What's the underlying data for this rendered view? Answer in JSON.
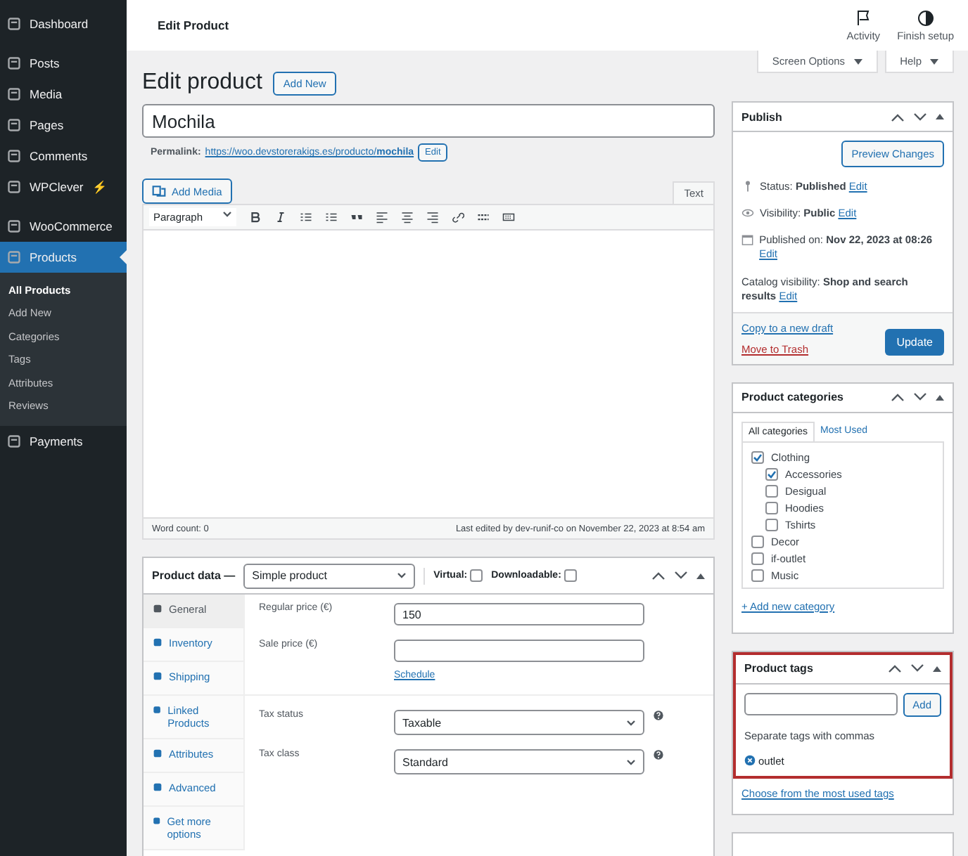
{
  "sidebar": {
    "items": [
      {
        "label": "Dashboard",
        "kind": "main",
        "selected": false
      },
      {
        "label": "Posts",
        "kind": "main",
        "selected": false
      },
      {
        "label": "Media",
        "kind": "main",
        "selected": false
      },
      {
        "label": "Pages",
        "kind": "main",
        "selected": false
      },
      {
        "label": "Comments",
        "kind": "main",
        "selected": false
      },
      {
        "label": "WPClever",
        "kind": "main",
        "selected": false,
        "badge": "⚡"
      },
      {
        "label": "WooCommerce",
        "kind": "main",
        "selected": false
      },
      {
        "label": "Products",
        "kind": "main",
        "selected": true
      },
      {
        "label": "All Products",
        "kind": "sub",
        "selected": true
      },
      {
        "label": "Add New",
        "kind": "sub",
        "selected": false
      },
      {
        "label": "Categories",
        "kind": "sub",
        "selected": false
      },
      {
        "label": "Tags",
        "kind": "sub",
        "selected": false
      },
      {
        "label": "Attributes",
        "kind": "sub",
        "selected": false
      },
      {
        "label": "Reviews",
        "kind": "sub",
        "selected": false
      },
      {
        "label": "Payments",
        "kind": "main",
        "selected": false
      }
    ]
  },
  "topbar": {
    "title": "Edit Product",
    "actions": [
      "Activity",
      "Finish setup"
    ]
  },
  "screen_buttons": [
    "Screen Options",
    "Help"
  ],
  "heading": {
    "title": "Edit product",
    "add_new": "Add New"
  },
  "product_title": "Mochila",
  "permalink": {
    "label": "Permalink:",
    "url_prefix": "https://woo.devstorerakigs.es/producto/",
    "slug": "mochila",
    "edit": "Edit"
  },
  "editor": {
    "add_media": "Add Media",
    "mode_tab": "Text",
    "format": "Paragraph",
    "word_count": "Word count: 0",
    "last_edited": "Last edited by dev-runif-co on November 22, 2023 at 8:54 am"
  },
  "product_data": {
    "label": "Product data —",
    "type": "Simple product",
    "checks": [
      {
        "label": "Virtual:",
        "checked": false
      },
      {
        "label": "Downloadable:",
        "checked": false
      }
    ],
    "tabs": [
      {
        "label": "General",
        "selected": true
      },
      {
        "label": "Inventory",
        "selected": false
      },
      {
        "label": "Shipping",
        "selected": false
      },
      {
        "label": "Linked Products",
        "selected": false
      },
      {
        "label": "Attributes",
        "selected": false
      },
      {
        "label": "Advanced",
        "selected": false
      },
      {
        "label": "Get more options",
        "selected": false
      }
    ],
    "fields": [
      {
        "kind": "input",
        "label": "Regular price (€)",
        "value": "150"
      },
      {
        "kind": "input",
        "label": "Sale price (€)",
        "link": "Schedule"
      },
      {
        "kind": "divider"
      },
      {
        "kind": "select",
        "label": "Tax status",
        "value": "Taxable"
      },
      {
        "kind": "select",
        "label": "Tax class",
        "value": "Standard"
      }
    ]
  },
  "publish": {
    "title": "Publish",
    "preview": "Preview Changes",
    "rows": [
      {
        "text": "Status: **Published**",
        "edit": "Edit"
      },
      {
        "text": "Visibility: **Public**",
        "edit": "Edit"
      },
      {
        "text": "Published on: **Nov 22, 2023 at 08:26**",
        "edit": "Edit"
      },
      {
        "text": "Catalog visibility: **Shop and search results**",
        "edit": "Edit"
      }
    ],
    "copy": "Copy to a new draft",
    "trash": "Move to Trash",
    "update": "Update"
  },
  "categories": {
    "title": "Product categories",
    "tabs": [
      {
        "label": "All categories",
        "selected": true
      },
      {
        "label": "Most Used",
        "selected": false
      }
    ],
    "items": [
      {
        "label": "Clothing",
        "checked": true,
        "children": [
          {
            "label": "Accessories",
            "checked": true
          },
          {
            "label": "Desigual",
            "checked": false
          },
          {
            "label": "Hoodies",
            "checked": false
          },
          {
            "label": "Tshirts",
            "checked": false
          }
        ]
      },
      {
        "label": "Decor",
        "checked": false
      },
      {
        "label": "if-outlet",
        "checked": false
      },
      {
        "label": "Music",
        "checked": false
      }
    ],
    "add": "+ Add new category"
  },
  "tags": {
    "title": "Product tags",
    "highlighted": true,
    "add": "Add",
    "hint": "Separate tags with commas",
    "tags": [
      "outlet"
    ],
    "choose": "Choose from the most used tags"
  }
}
